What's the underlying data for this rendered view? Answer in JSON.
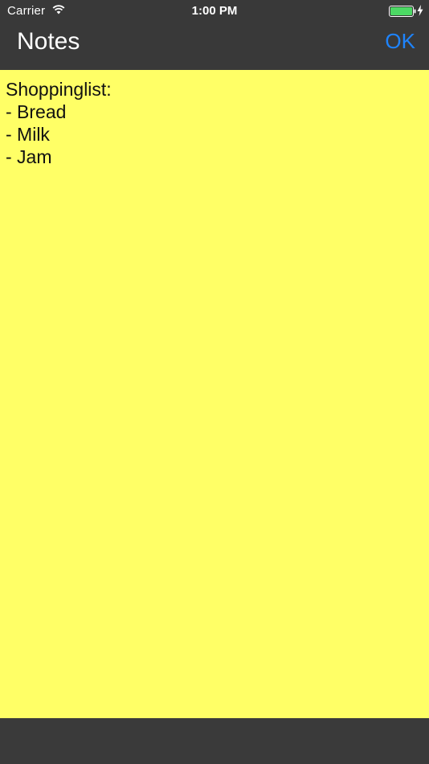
{
  "status_bar": {
    "carrier": "Carrier",
    "time": "1:00 PM",
    "wifi_icon": "wifi-icon",
    "battery_icon": "battery-icon",
    "charging_icon": "charging-bolt-icon",
    "battery_color": "#4cd964"
  },
  "nav": {
    "title": "Notes",
    "ok_label": "OK",
    "ok_color": "#1e84ff"
  },
  "note": {
    "text": "Shoppinglist:\n- Bread\n- Milk\n- Jam",
    "background": "#ffff66"
  },
  "colors": {
    "bar_background": "#393939"
  }
}
